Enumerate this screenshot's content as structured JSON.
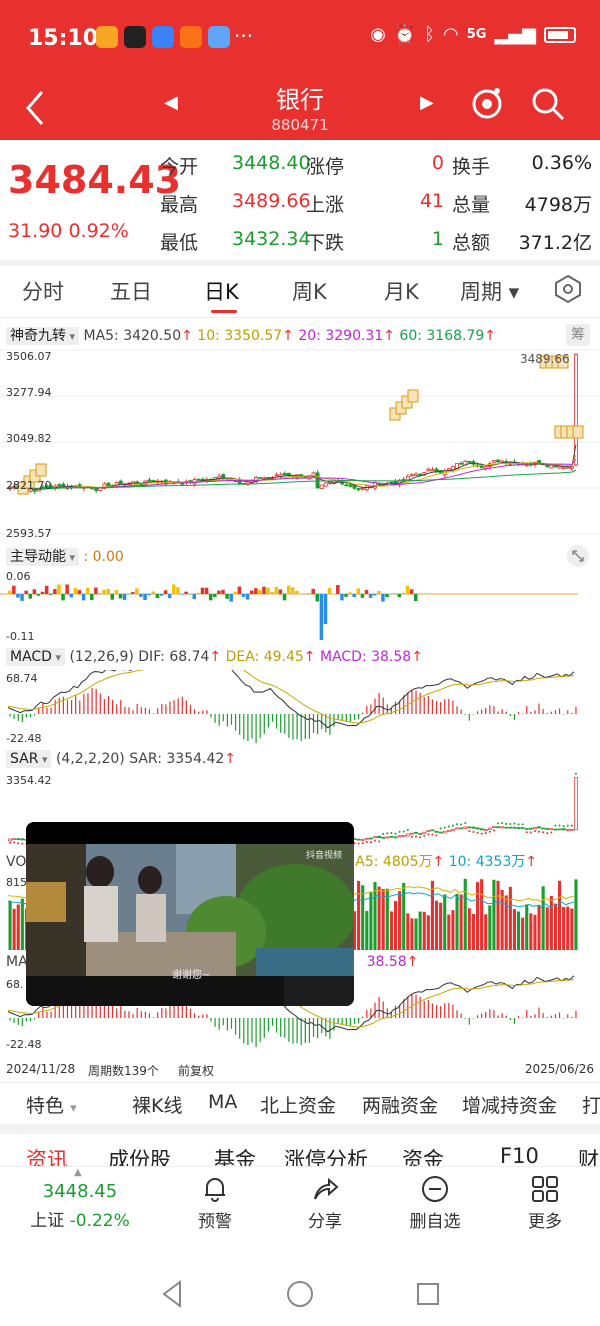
{
  "status_bar": {
    "time": "15:10",
    "dots": "···",
    "network": "5G"
  },
  "header": {
    "title": "银行",
    "code": "880471"
  },
  "quote": {
    "price": "3484.43",
    "change": "31.90",
    "change_pct": "0.92%",
    "rows": [
      {
        "l1": "今开",
        "v1": "3448.40",
        "l2": "涨停",
        "v2": "0",
        "l3": "换手",
        "v3": "0.36%"
      },
      {
        "l1": "最高",
        "v1": "3489.66",
        "l2": "上涨",
        "v2": "41",
        "l3": "总量",
        "v3": "4798万"
      },
      {
        "l1": "最低",
        "v1": "3432.34",
        "l2": "下跌",
        "v2": "1",
        "l3": "总额",
        "v3": "371.2亿"
      }
    ]
  },
  "tabs": [
    "分时",
    "五日",
    "日K",
    "周K",
    "月K",
    "周期"
  ],
  "active_tab": "日K",
  "main_chart": {
    "indicator": "神奇九转",
    "ma5": "MA5: 3420.50",
    "ma10": "10: 3350.57",
    "ma20": "20: 3290.31",
    "ma60": "60: 3168.79",
    "chip_badge": "筹",
    "y_ticks": [
      "3506.07",
      "3277.94",
      "3049.82",
      "2821.70",
      "2593.57"
    ],
    "high_label": "3489.66"
  },
  "main_force": {
    "name": "主导动能",
    "value": ": 0.00",
    "y_top": "0.06",
    "y_bottom": "-0.11"
  },
  "macd": {
    "name": "MACD",
    "params": "(12,26,9)",
    "dif": "DIF: 68.74",
    "dea": "DEA: 49.45",
    "macd": "MACD: 38.58",
    "y_top": "68.74",
    "y_bottom": "-22.48"
  },
  "sar": {
    "name": "SAR",
    "params": "(4,2,2,20)",
    "value": "SAR: 3354.42",
    "y_top": "3354.42"
  },
  "vol": {
    "ma5": "A5: 4805万",
    "ma10": "10: 4353万",
    "y_top": "815"
  },
  "macd2": {
    "macd": "38.58",
    "y_top": "68.",
    "y_bottom": "-22.48"
  },
  "footer": {
    "start_date": "2024/11/28",
    "period_count": "周期数139个",
    "adjust": "前复权",
    "end_date": "2025/06/26"
  },
  "features": [
    "特色",
    "裸K线",
    "MA",
    "北上资金",
    "两融资金",
    "增减持资金",
    "打"
  ],
  "news_tabs": [
    "资讯",
    "成份股",
    "基金",
    "涨停分析",
    "资金",
    "F10",
    "财"
  ],
  "bottom": {
    "index_value": "3448.45",
    "index_name": "上证",
    "index_change": "-0.22%",
    "buttons": [
      "预警",
      "分享",
      "删自选",
      "更多"
    ]
  },
  "video": {
    "watermark": "抖音视频",
    "caption": "谢谢您~"
  },
  "colors": {
    "up": "#e8302f",
    "down": "#1a9d2c",
    "header_bg": "#e8302f"
  }
}
